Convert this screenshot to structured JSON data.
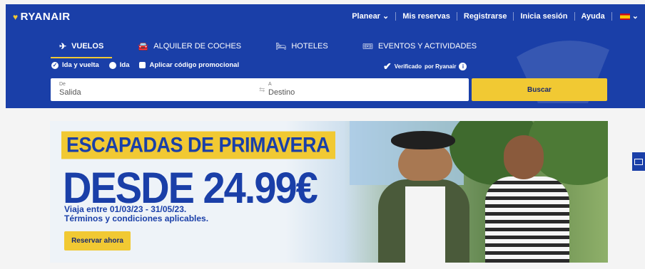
{
  "header": {
    "logo_text": "RYANAIR",
    "nav": [
      {
        "label": "Planear",
        "chevron": "⌄"
      },
      {
        "label": "Mis reservas"
      },
      {
        "label": "Registrarse"
      },
      {
        "label": "Inicia sesión"
      },
      {
        "label": "Ayuda"
      }
    ],
    "language_flag": "es-flag",
    "language_chevron": "⌄"
  },
  "tabs": [
    {
      "label": "VUELOS",
      "icon": "plane-icon",
      "glyph": "✈",
      "active": true
    },
    {
      "label": "ALQUILER DE COCHES",
      "icon": "car-icon",
      "glyph": "🚘",
      "active": false
    },
    {
      "label": "HOTELES",
      "icon": "bed-icon",
      "glyph": "🛏",
      "active": false
    },
    {
      "label": "EVENTOS Y ACTIVIDADES",
      "icon": "ticket-icon",
      "glyph": "🎟",
      "active": false
    }
  ],
  "trip_options": {
    "round_trip": "Ida y vuelta",
    "one_way": "Ida",
    "promo_code": "Aplicar código promocional",
    "selected": "round_trip"
  },
  "verified": {
    "label_bold": "Verificado",
    "label_rest": "por Ryanair"
  },
  "search": {
    "from_label": "De",
    "from_placeholder": "Salida",
    "to_label": "A",
    "to_placeholder": "Destino",
    "button": "Buscar"
  },
  "banner": {
    "headline": "ESCAPADAS DE PRIMAVERA",
    "price": "DESDE 24.99€",
    "dates_line1": "Viaja entre 01/03/23 - 31/05/23.",
    "dates_line2": "Términos y condiciones aplicables.",
    "cta": "Reservar ahora"
  },
  "colors": {
    "brand_blue": "#1a3fa8",
    "brand_yellow": "#f1c933"
  }
}
